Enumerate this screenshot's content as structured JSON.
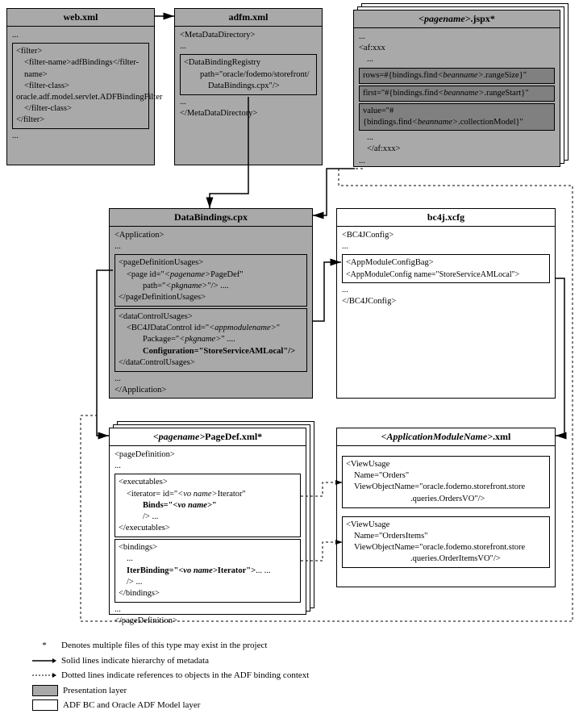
{
  "webxml": {
    "title": "web.xml",
    "dots": "...",
    "filter_open": "<filter>",
    "filter_name": "<filter-name>adfBindings</filter-name>",
    "filter_class_open": "<filter-class>",
    "filter_class_val": "oracle.adf.model.servlet.ADFBindingFilter",
    "filter_class_close": "</filter-class>",
    "filter_close": "</filter>"
  },
  "adfm": {
    "title": "adfm.xml",
    "mdd_open": "<MetaDataDirectory>",
    "dots": "...",
    "dbr_open": "<DataBindingRegistry",
    "dbr_path": "path=\"oracle/fodemo/storefront/",
    "dbr_path2": "DataBindings.cpx\"/>",
    "mdd_close": "</MetaDataDirectory>"
  },
  "jspx": {
    "title_prefix": "<pagename>",
    "title_suffix": ".jspx*",
    "dots": "...",
    "afxxx_open": "<af:xxx",
    "row_line": "rows=#{bindings.find<beanname>.rangeSize}\"",
    "first_line": "first=\"#{bindings.find<beanname>.rangeStart}\"",
    "value_line": "value=\"#{bindings.find<beanname>.collectionModel}\"",
    "afxxx_close": "</af:xxx>"
  },
  "databindings": {
    "title": "DataBindings.cpx",
    "app_open": "<Application>",
    "dots": "...",
    "pdu_open": "<pageDefinitionUsages>",
    "page_open": "<page id=\"",
    "page_ital": "<pagename>",
    "page_after": "PageDef\"",
    "page_path": "path=\"",
    "pkgname": "<pkgname>",
    "page_path_close": "\"/>  ....",
    "pdu_close": "</pageDefinitionUsages>",
    "dcu_open": "<dataControlUsages>",
    "bc4j_open": "<BC4JDataControl  id=\"",
    "appmod": "<appmodulename>",
    "bc4j_after": "\"",
    "pkg_line": "Package=\"",
    "pkg_close": "\" ....",
    "config_line": "Configuration=\"StoreServiceAMLocal\"/>",
    "dcu_close": "</dataControlUsages>",
    "app_close": "</Application>"
  },
  "bc4j": {
    "title": "bc4j.xcfg",
    "cfg_open": "<BC4JConfig>",
    "dots": "...",
    "bag_open": "<AppModuleConfigBag>",
    "cfg_line": "<AppModuleConfig name=\"StoreServiceAMLocal\">",
    "cfg_close": "</BC4JConfig>"
  },
  "pagedef": {
    "title_prefix": "<pagename>",
    "title_suffix": "PageDef.xml*",
    "pd_open": "<pageDefinition>",
    "dots": "...",
    "exec_open": "<executables>",
    "iter_open": "<iterator=  id=\"",
    "voname": "<vo name>",
    "iter_after": "Iterator\"",
    "binds": "Binds=\"",
    "binds_close": "\"",
    "iter_close": "/> ...",
    "exec_close": "</executables>",
    "bind_open": "<bindings>",
    "iterb": "IterBinding=\"",
    "iterb_after": "Iterator\">",
    "ellip": "... ...",
    "slash": "/> ...",
    "bind_close": "</bindings>",
    "pd_close": "</pageDefinition>"
  },
  "appmodule": {
    "title_prefix": "<ApplicationModuleName>",
    "title_suffix": ".xml",
    "vu1_open": "<ViewUsage",
    "vu1_name": "Name=\"Orders\"",
    "vu1_vo": "ViewObjectName=\"oracle.fodemo.storefront.store",
    "vu1_vo2": ".queries.OrdersVO\"/>",
    "vu2_name": "Name=\"OrdersItems\"",
    "vu2_vo": "ViewObjectName=\"oracle.fodemo.storefront.store",
    "vu2_vo2": ".queries.OrderItemsVO\"/>"
  },
  "legend": {
    "star": "*",
    "star_text": "Denotes multiple files of this type may exist in the project",
    "solid": "Solid lines indicate hierarchy of metadata",
    "dotted": "Dotted lines indicate references to objects in the ADF binding context",
    "pres": "Presentation layer",
    "adfbc": "ADF BC and Oracle ADF Model layer"
  }
}
